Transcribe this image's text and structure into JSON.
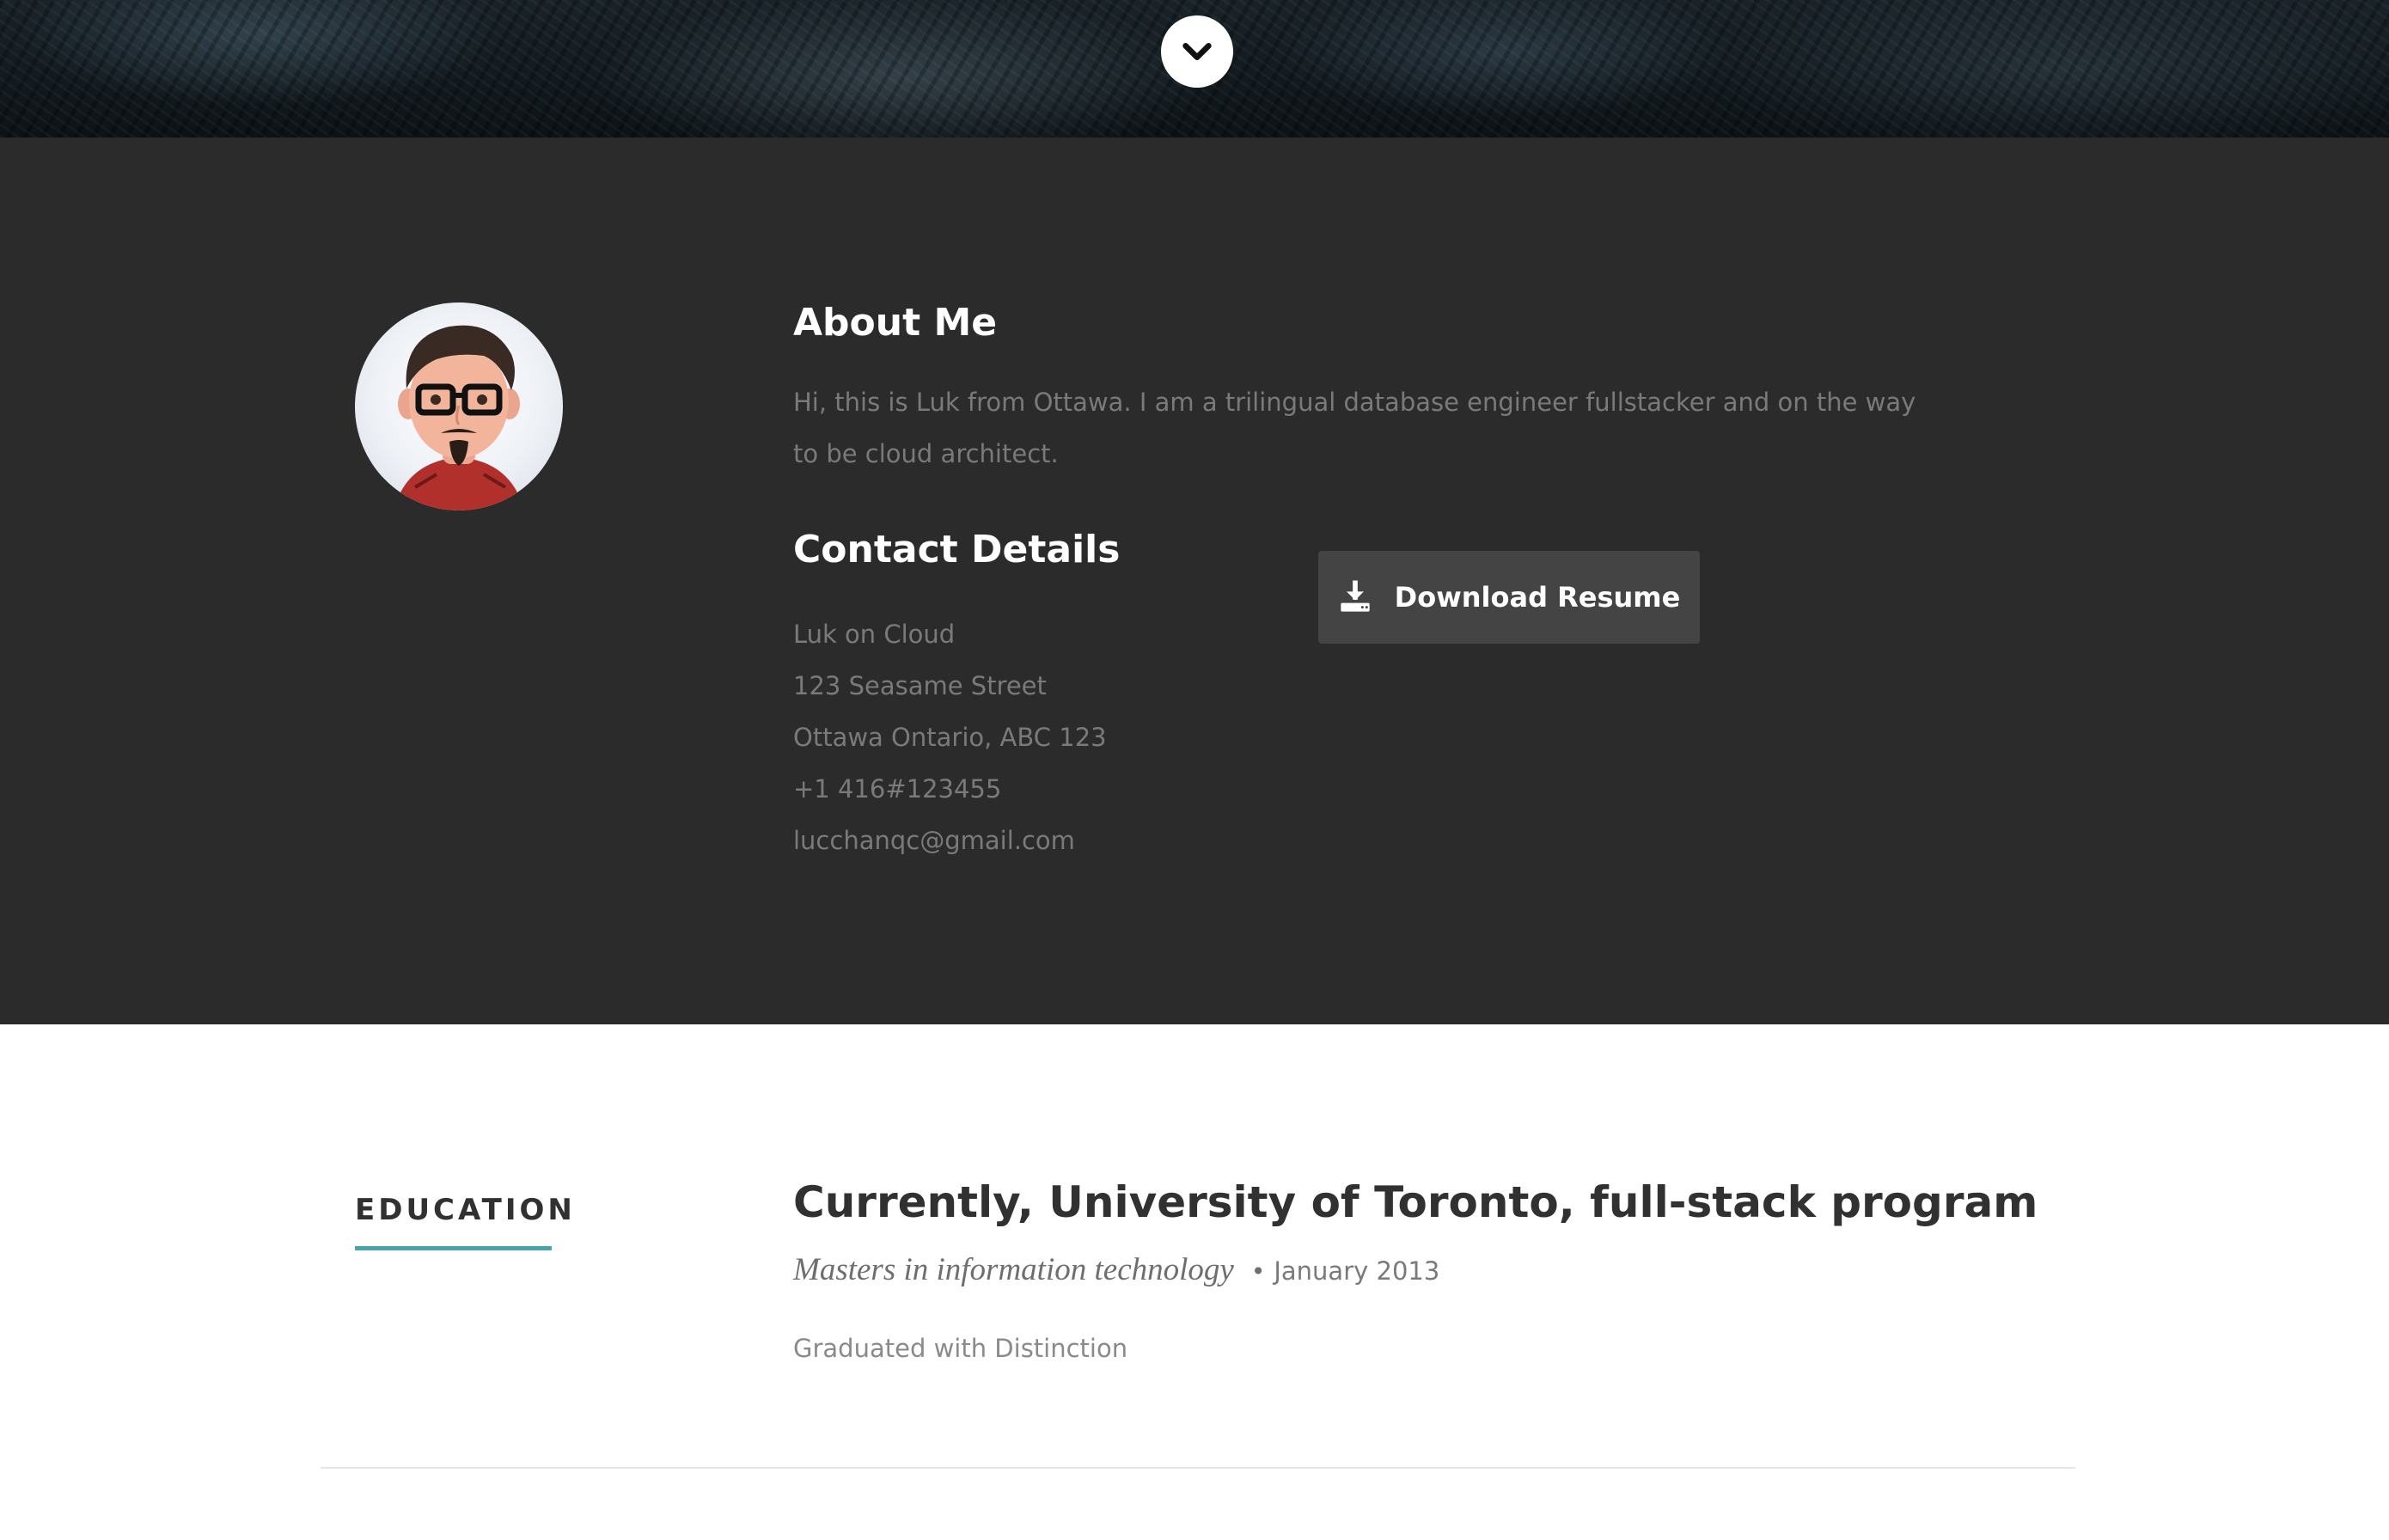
{
  "hero": {
    "scroll_icon": "chevron-down-icon"
  },
  "about": {
    "avatar_icon": "avatar-illustration",
    "title": "About Me",
    "text": "Hi, this is Luk from Ottawa. I am a trilingual database engineer fullstacker and on the way to be cloud architect."
  },
  "contact": {
    "title": "Contact Details",
    "name": "Luk on Cloud",
    "street": "123 Seasame Street",
    "city": "Ottawa Ontario, ABC 123",
    "phone": "+1 416#123455",
    "email": "lucchanqc@gmail.com"
  },
  "download": {
    "label": "Download Resume",
    "icon": "download-icon"
  },
  "education": {
    "section_label": "EDUCATION",
    "school": "Currently, University of Toronto, full-stack program",
    "degree": "Masters in information technology",
    "bullet": "•",
    "date": "January 2013",
    "description": "Graduated with Distinction"
  },
  "colors": {
    "hero_dark": "#121a1f",
    "about_bg": "#2b2b2b",
    "button_bg": "#444444",
    "accent_teal": "#45a7a8",
    "muted_text": "#7a7a7a",
    "heading_dark": "#313131"
  }
}
